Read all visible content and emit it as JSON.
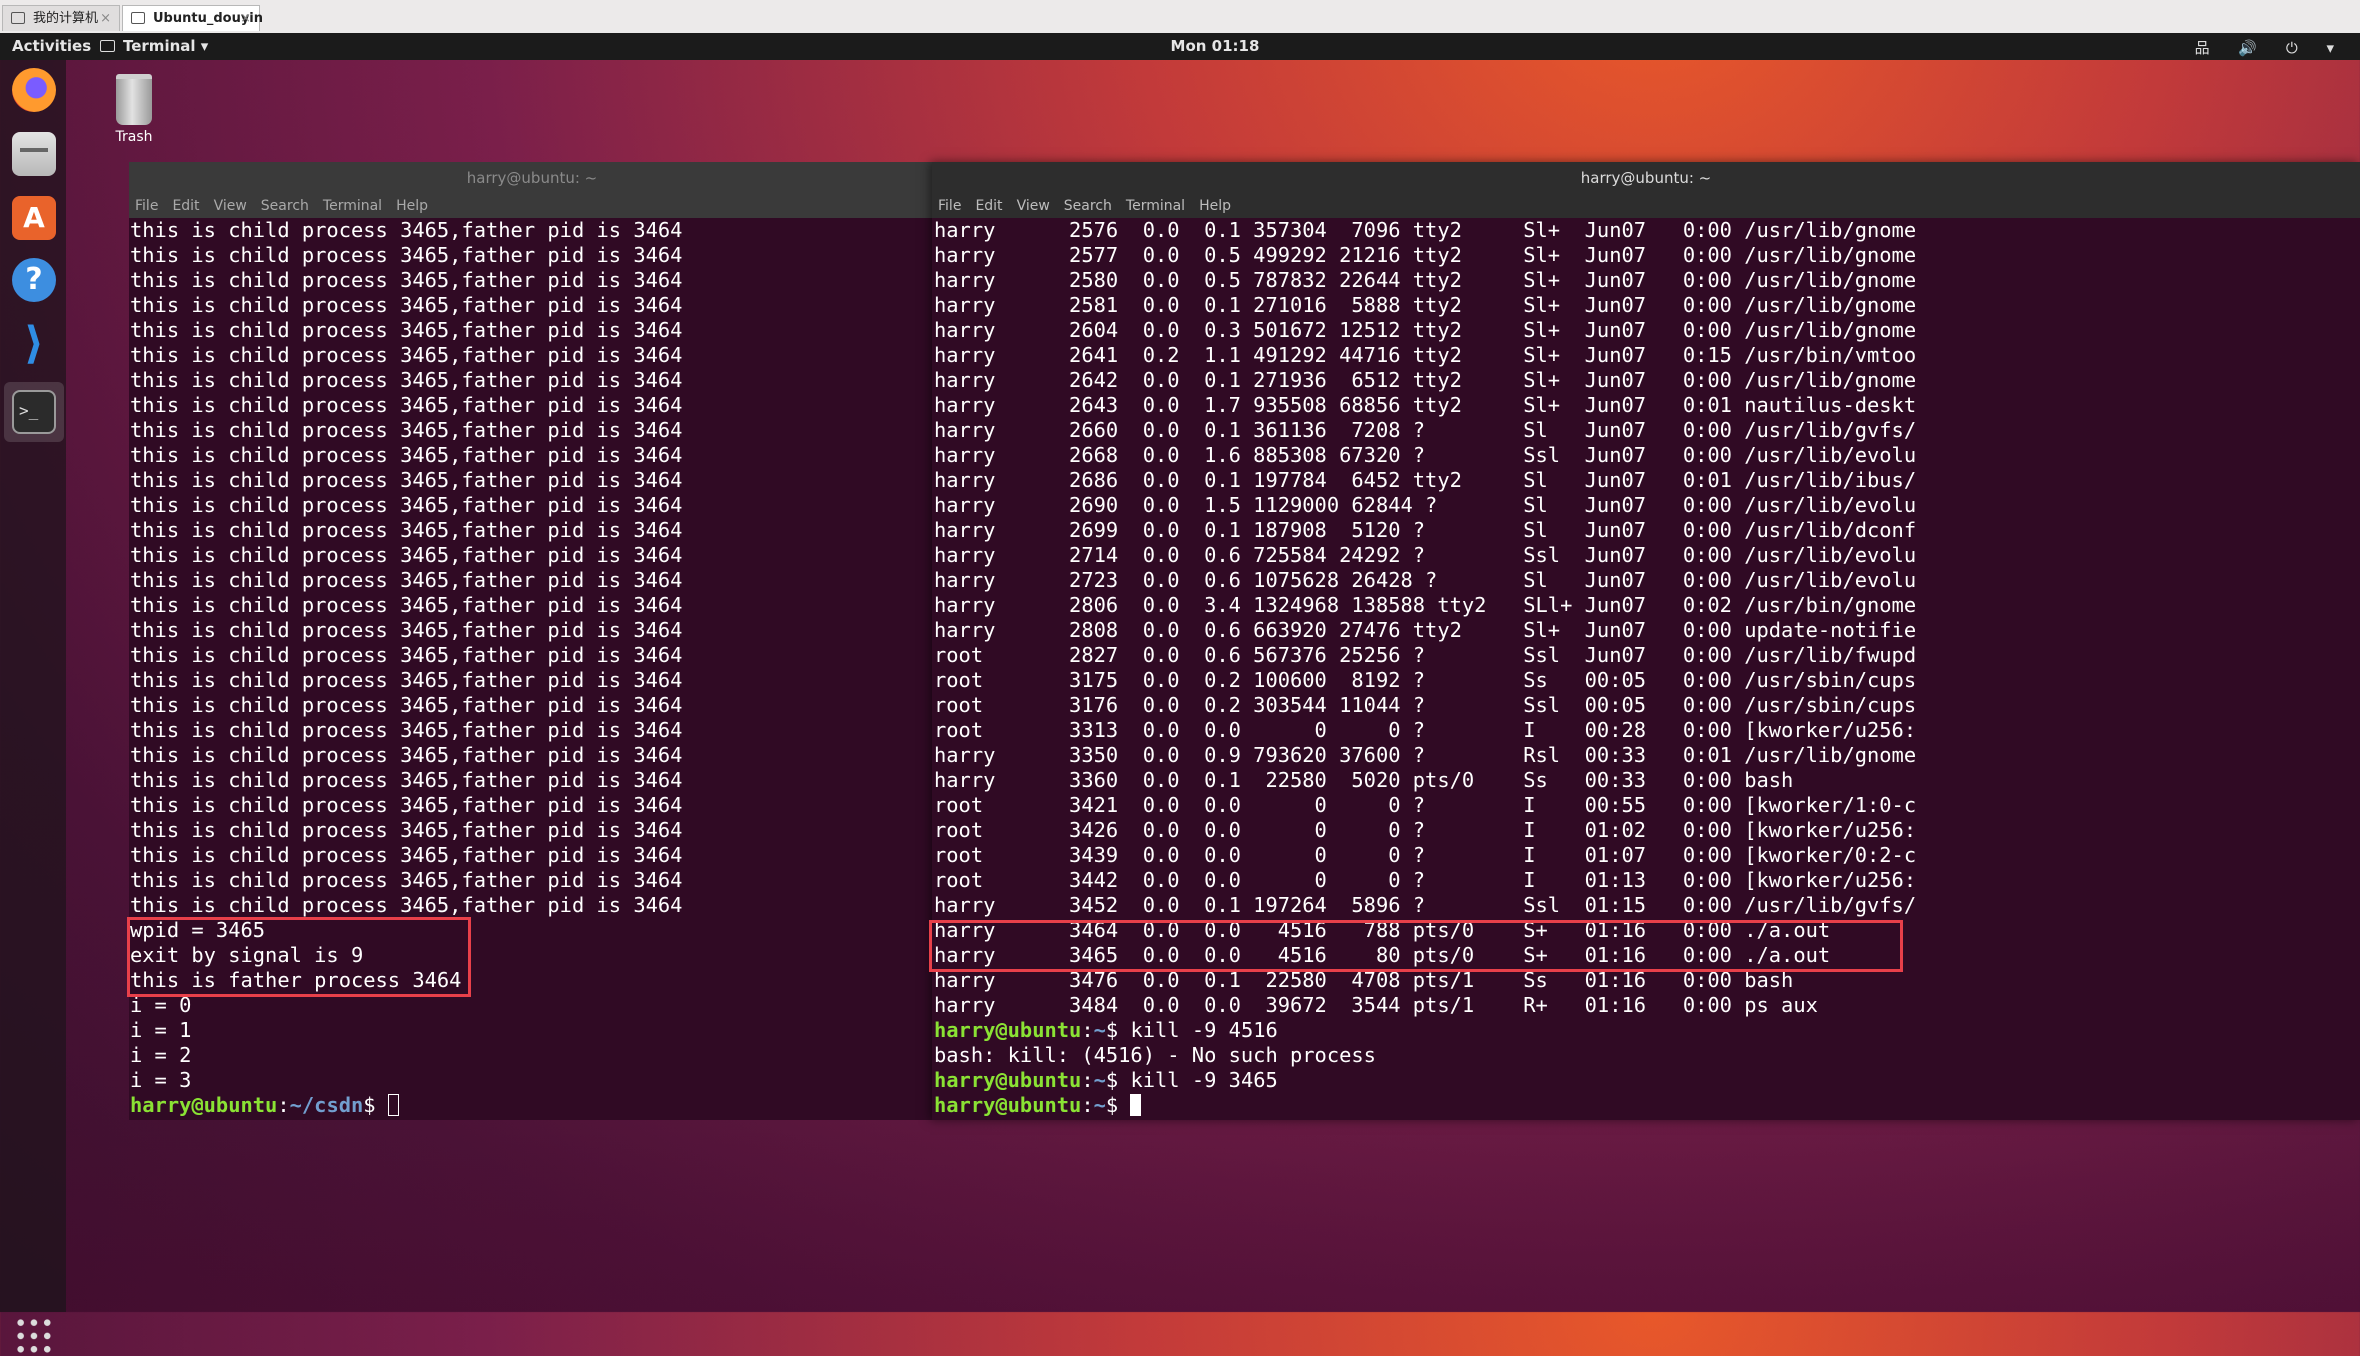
{
  "host_tabs": [
    {
      "label": "我的计算机",
      "active": false
    },
    {
      "label": "Ubuntu_douyin",
      "active": true
    }
  ],
  "topbar": {
    "activities": "Activities",
    "app_menu": "Terminal ▾",
    "clock": "Mon 01:18",
    "tray": "品 🔊 ⏻ ▾"
  },
  "dock": {
    "items": [
      "firefox-icon",
      "files-icon",
      "software-center-icon",
      "help-icon",
      "vscode-icon",
      "terminal-icon",
      "show-apps-icon"
    ],
    "store_glyph": "A",
    "help_glyph": "?",
    "code_glyph": "⟩",
    "term_glyph": ">_"
  },
  "desktop": {
    "trash_label": "Trash"
  },
  "menu_items": [
    "File",
    "Edit",
    "View",
    "Search",
    "Terminal",
    "Help"
  ],
  "left_terminal": {
    "title": "harry@ubuntu: ~",
    "lines": [
      "this is child process 3465,father pid is 3464",
      "this is child process 3465,father pid is 3464",
      "this is child process 3465,father pid is 3464",
      "this is child process 3465,father pid is 3464",
      "this is child process 3465,father pid is 3464",
      "this is child process 3465,father pid is 3464",
      "this is child process 3465,father pid is 3464",
      "this is child process 3465,father pid is 3464",
      "this is child process 3465,father pid is 3464",
      "this is child process 3465,father pid is 3464",
      "this is child process 3465,father pid is 3464",
      "this is child process 3465,father pid is 3464",
      "this is child process 3465,father pid is 3464",
      "this is child process 3465,father pid is 3464",
      "this is child process 3465,father pid is 3464",
      "this is child process 3465,father pid is 3464",
      "this is child process 3465,father pid is 3464",
      "this is child process 3465,father pid is 3464",
      "this is child process 3465,father pid is 3464",
      "this is child process 3465,father pid is 3464",
      "this is child process 3465,father pid is 3464",
      "this is child process 3465,father pid is 3464",
      "this is child process 3465,father pid is 3464",
      "this is child process 3465,father pid is 3464",
      "this is child process 3465,father pid is 3464",
      "this is child process 3465,father pid is 3464",
      "this is child process 3465,father pid is 3464",
      "this is child process 3465,father pid is 3464",
      "wpid = 3465",
      "exit by signal is 9",
      "this is father process 3464",
      "i = 0",
      "i = 1",
      "i = 2",
      "i = 3"
    ],
    "prompt_user": "harry@ubuntu",
    "prompt_path": "~/csdn",
    "prompt_suffix": "$ "
  },
  "right_terminal": {
    "title": "harry@ubuntu: ~",
    "lines": [
      "harry      2576  0.0  0.1 357304  7096 tty2     Sl+  Jun07   0:00 /usr/lib/gnome",
      "harry      2577  0.0  0.5 499292 21216 tty2     Sl+  Jun07   0:00 /usr/lib/gnome",
      "harry      2580  0.0  0.5 787832 22644 tty2     Sl+  Jun07   0:00 /usr/lib/gnome",
      "harry      2581  0.0  0.1 271016  5888 tty2     Sl+  Jun07   0:00 /usr/lib/gnome",
      "harry      2604  0.0  0.3 501672 12512 tty2     Sl+  Jun07   0:00 /usr/lib/gnome",
      "harry      2641  0.2  1.1 491292 44716 tty2     Sl+  Jun07   0:15 /usr/bin/vmtoo",
      "harry      2642  0.0  0.1 271936  6512 tty2     Sl+  Jun07   0:00 /usr/lib/gnome",
      "harry      2643  0.0  1.7 935508 68856 tty2     Sl+  Jun07   0:01 nautilus-deskt",
      "harry      2660  0.0  0.1 361136  7208 ?        Sl   Jun07   0:00 /usr/lib/gvfs/",
      "harry      2668  0.0  1.6 885308 67320 ?        Ssl  Jun07   0:00 /usr/lib/evolu",
      "harry      2686  0.0  0.1 197784  6452 tty2     Sl   Jun07   0:01 /usr/lib/ibus/",
      "harry      2690  0.0  1.5 1129000 62844 ?       Sl   Jun07   0:00 /usr/lib/evolu",
      "harry      2699  0.0  0.1 187908  5120 ?        Sl   Jun07   0:00 /usr/lib/dconf",
      "harry      2714  0.0  0.6 725584 24292 ?        Ssl  Jun07   0:00 /usr/lib/evolu",
      "harry      2723  0.0  0.6 1075628 26428 ?       Sl   Jun07   0:00 /usr/lib/evolu",
      "harry      2806  0.0  3.4 1324968 138588 tty2   SLl+ Jun07   0:02 /usr/bin/gnome",
      "harry      2808  0.0  0.6 663920 27476 tty2     Sl+  Jun07   0:00 update-notifie",
      "root       2827  0.0  0.6 567376 25256 ?        Ssl  Jun07   0:00 /usr/lib/fwupd",
      "root       3175  0.0  0.2 100600  8192 ?        Ss   00:05   0:00 /usr/sbin/cups",
      "root       3176  0.0  0.2 303544 11044 ?        Ssl  00:05   0:00 /usr/sbin/cups",
      "root       3313  0.0  0.0      0     0 ?        I    00:28   0:00 [kworker/u256:",
      "harry      3350  0.0  0.9 793620 37600 ?        Rsl  00:33   0:01 /usr/lib/gnome",
      "harry      3360  0.0  0.1  22580  5020 pts/0    Ss   00:33   0:00 bash",
      "root       3421  0.0  0.0      0     0 ?        I    00:55   0:00 [kworker/1:0-c",
      "root       3426  0.0  0.0      0     0 ?        I    01:02   0:00 [kworker/u256:",
      "root       3439  0.0  0.0      0     0 ?        I    01:07   0:00 [kworker/0:2-c",
      "root       3442  0.0  0.0      0     0 ?        I    01:13   0:00 [kworker/u256:",
      "harry      3452  0.0  0.1 197264  5896 ?        Ssl  01:15   0:00 /usr/lib/gvfs/",
      "harry      3464  0.0  0.0   4516   788 pts/0    S+   01:16   0:00 ./a.out",
      "harry      3465  0.0  0.0   4516    80 pts/0    S+   01:16   0:00 ./a.out",
      "harry      3476  0.0  0.1  22580  4708 pts/1    Ss   01:16   0:00 bash",
      "harry      3484  0.0  0.0  39672  3544 pts/1    R+   01:16   0:00 ps aux"
    ],
    "session": [
      {
        "type": "prompt",
        "user": "harry@ubuntu",
        "path": "~",
        "cmd": "kill -9 4516"
      },
      {
        "type": "output",
        "text": "bash: kill: (4516) - No such process"
      },
      {
        "type": "prompt",
        "user": "harry@ubuntu",
        "path": "~",
        "cmd": "kill -9 3465"
      },
      {
        "type": "prompt",
        "user": "harry@ubuntu",
        "path": "~",
        "cmd": ""
      }
    ]
  },
  "colors": {
    "terminal_bg": "#300a24",
    "prompt_user": "#8ae234",
    "prompt_path": "#729fcf",
    "highlight": "#e8404a"
  }
}
